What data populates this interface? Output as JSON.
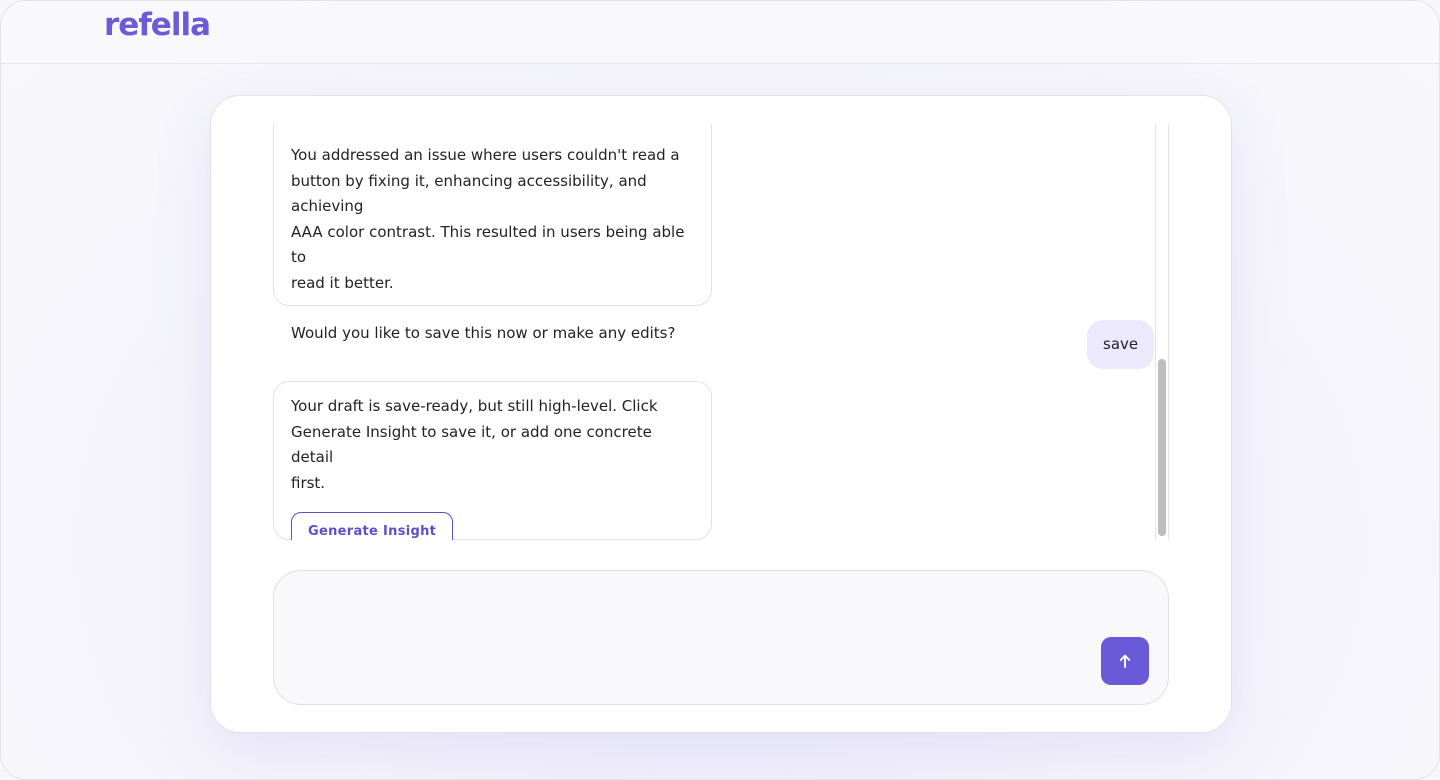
{
  "header": {
    "logo_text": "refella",
    "brand_color": "#6c5ad6"
  },
  "chat": {
    "messages": [
      {
        "role": "assistant",
        "paragraphs": [
          "You addressed an issue where users couldn't read a\nbutton by fixing it, enhancing accessibility, and achieving\nAAA color contrast. This resulted in users being able to\nread it better.",
          "Would you like to save this now or make any edits?"
        ]
      },
      {
        "role": "user",
        "text": "save"
      },
      {
        "role": "assistant",
        "paragraphs": [
          "Your draft is save-ready, but still high-level. Click\nGenerate Insight to save it, or add one concrete detail\nfirst."
        ],
        "action_label": "Generate Insight"
      }
    ]
  },
  "composer": {
    "value": "",
    "placeholder": "",
    "send_icon": "arrow-up-icon",
    "send_color": "#6b5ad8"
  }
}
